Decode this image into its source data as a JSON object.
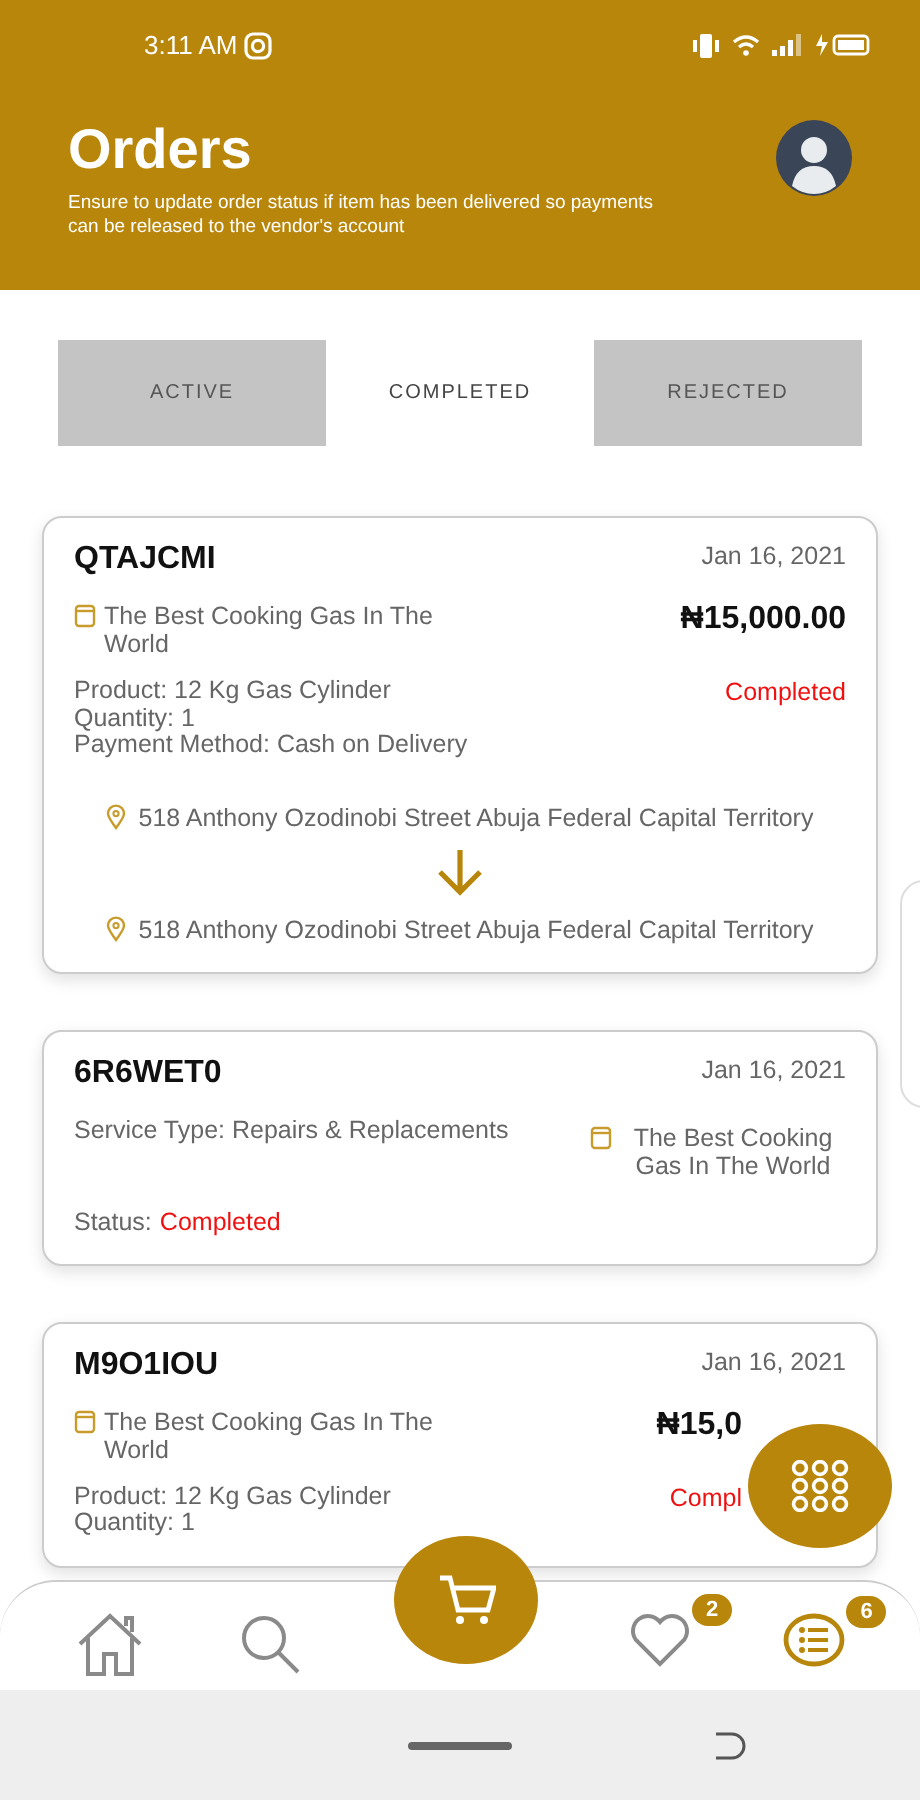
{
  "status_bar": {
    "time": "3:11 AM"
  },
  "header": {
    "title": "Orders",
    "subtitle": "Ensure to update order status if item has been delivered so payments can be released to the vendor's account"
  },
  "tabs": [
    {
      "label": "ACTIVE",
      "selected": false
    },
    {
      "label": "COMPLETED",
      "selected": true
    },
    {
      "label": "REJECTED",
      "selected": false
    }
  ],
  "orders": [
    {
      "kind": "product",
      "code": "QTAJCMI",
      "date": "Jan 16, 2021",
      "vendor": "The Best Cooking Gas In The World",
      "amount": "₦15,000.00",
      "details": [
        "Product: 12 Kg Gas Cylinder",
        "Quantity: 1",
        "Payment Method: Cash on Delivery"
      ],
      "status": "Completed",
      "from": "518 Anthony Ozodinobi Street Abuja Federal Capital Territory",
      "to": "518 Anthony Ozodinobi Street Abuja Federal Capital Territory"
    },
    {
      "kind": "service",
      "code": "6R6WET0",
      "date": "Jan 16, 2021",
      "service": "Service Type: Repairs & Replacements",
      "vendor": "The Best Cooking Gas In The World",
      "status_label": "Status:",
      "status": "Completed"
    },
    {
      "kind": "product",
      "code": "M9O1IOU",
      "date": "Jan 16, 2021",
      "vendor": "The Best Cooking Gas In The World",
      "amount": "₦15,0",
      "details": [
        "Product: 12 Kg Gas Cylinder",
        "Quantity: 1"
      ],
      "status": "Compl",
      "truncated": true
    }
  ],
  "bottom_nav": {
    "favorites_badge": "2",
    "orders_badge": "6"
  }
}
